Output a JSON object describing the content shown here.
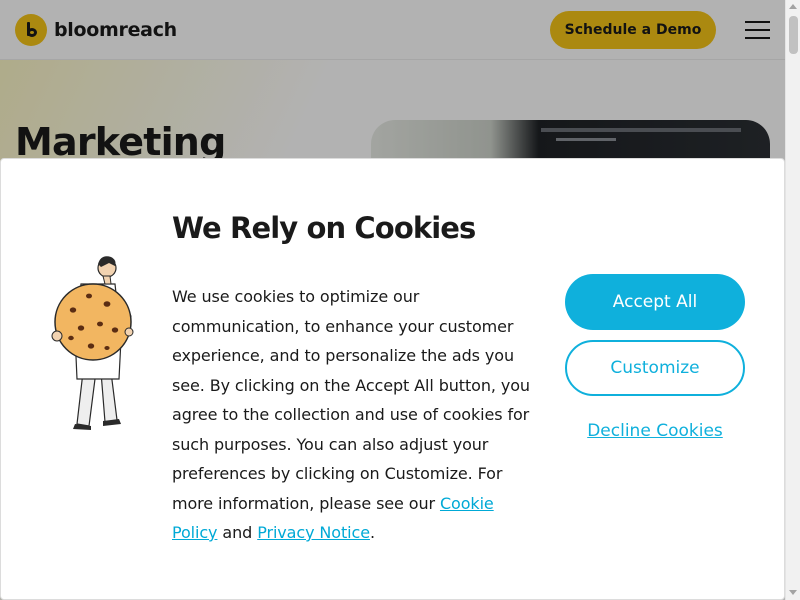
{
  "header": {
    "logo_text": "bloomreach",
    "demo_button": "Schedule a Demo",
    "menu_icon": "hamburger-menu-icon"
  },
  "hero": {
    "title": "Marketing"
  },
  "cookie_dialog": {
    "title": "We Rely on Cookies",
    "body_text": "We use cookies to optimize our communication, to enhance your customer experience, and to personalize the ads you see. By clicking on the Accept All button, you agree to the collection and use of cookies for such purposes. You can also adjust your preferences by clicking on Customize. For more information, please see our ",
    "cookie_policy_link": "Cookie Policy",
    "and_text": " and ",
    "privacy_notice_link": "Privacy Notice",
    "end_text": ".",
    "accept_button": "Accept All",
    "customize_button": "Customize",
    "decline_link": "Decline Cookies",
    "illustration": "person-holding-cookie-illustration"
  },
  "colors": {
    "brand_yellow": "#f5c518",
    "accent_cyan": "#0fb0dc",
    "text_dark": "#1a1a1a"
  }
}
